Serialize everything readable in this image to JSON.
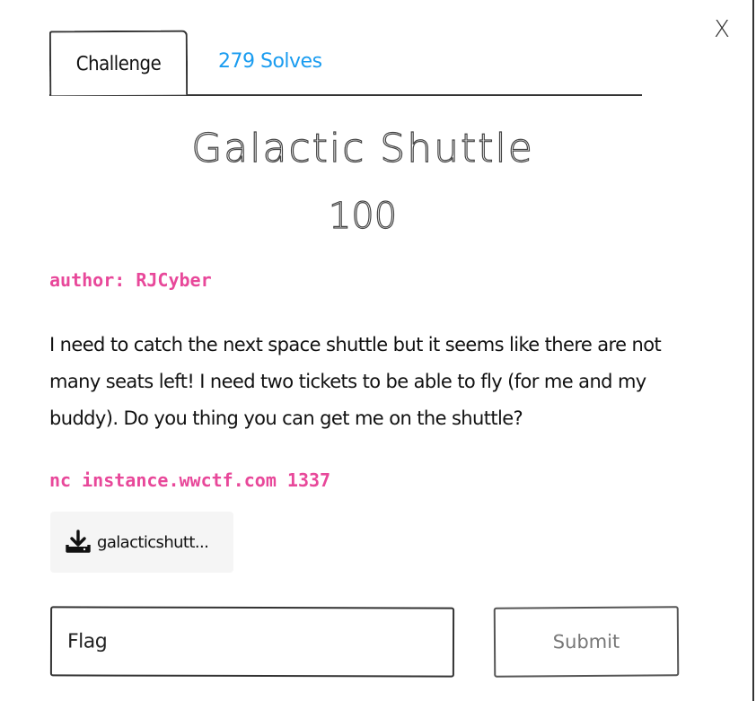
{
  "modal": {
    "close_label": "X"
  },
  "tabs": {
    "challenge_label": "Challenge",
    "solves_label": "279 Solves"
  },
  "challenge": {
    "name": "Galactic Shuttle",
    "points": "100",
    "author": "author: RJCyber",
    "description": "I need to catch the next space shuttle but it seems like there are not many seats left! I need two tickets to be able to fly (for me and my buddy). Do you thing you can get me on the shuttle?",
    "connection": "nc instance.wwctf.com 1337"
  },
  "file": {
    "icon": "download-icon",
    "label": "galacticshutt..."
  },
  "form": {
    "flag_placeholder": "Flag",
    "submit_label": "Submit"
  },
  "colors": {
    "accent_pink": "#e8489a",
    "link_blue": "#1a9cf0"
  }
}
